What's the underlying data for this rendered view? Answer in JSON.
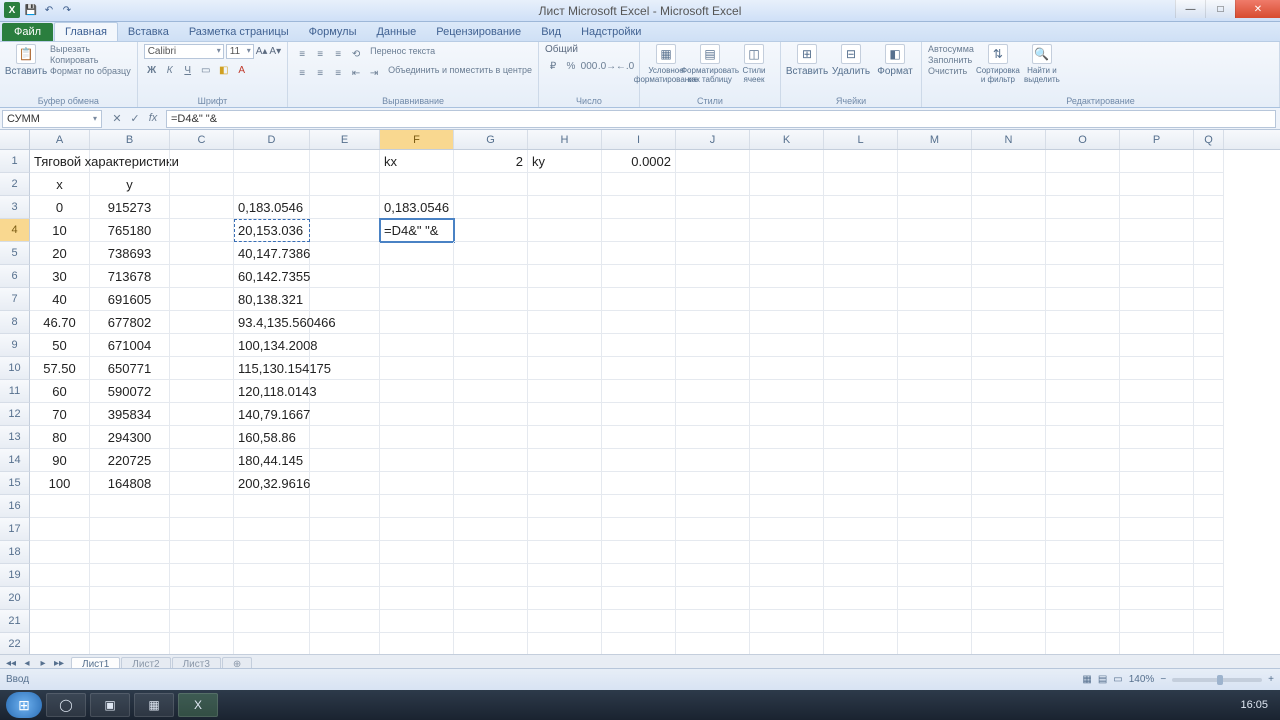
{
  "app": {
    "title": "Лист Microsoft Excel - Microsoft Excel"
  },
  "tabs": {
    "file": "Файл",
    "items": [
      "Главная",
      "Вставка",
      "Разметка страницы",
      "Формулы",
      "Данные",
      "Рецензирование",
      "Вид",
      "Надстройки"
    ],
    "active": 0
  },
  "ribbon": {
    "clipboard": {
      "paste": "Вставить",
      "cut": "Вырезать",
      "copy": "Копировать",
      "format": "Формат по образцу",
      "label": "Буфер обмена"
    },
    "font": {
      "name": "Calibri",
      "size": "11",
      "label": "Шрифт"
    },
    "alignment": {
      "wrap": "Перенос текста",
      "merge": "Объединить и поместить в центре",
      "label": "Выравнивание"
    },
    "number": {
      "format": "Общий",
      "label": "Число"
    },
    "styles": {
      "cond": "Условное форматирование",
      "table": "Форматировать как таблицу",
      "cell": "Стили ячеек",
      "label": "Стили"
    },
    "cells": {
      "insert": "Вставить",
      "delete": "Удалить",
      "format": "Формат",
      "label": "Ячейки"
    },
    "editing": {
      "sum": "Автосумма",
      "fill": "Заполнить",
      "clear": "Очистить",
      "sort": "Сортировка и фильтр",
      "find": "Найти и выделить",
      "label": "Редактирование"
    }
  },
  "namebox": "СУММ",
  "formula": "=D4&\" \"&",
  "columns": [
    "A",
    "B",
    "C",
    "D",
    "E",
    "F",
    "G",
    "H",
    "I",
    "J",
    "K",
    "L",
    "M",
    "N",
    "O",
    "P",
    "Q"
  ],
  "active_col": "F",
  "active_row": 4,
  "cells": {
    "r1": {
      "A": "Тяговой характеристики",
      "F": "kx",
      "G": "2",
      "H": "ky",
      "I": "0.0002"
    },
    "r2": {
      "A": "x",
      "B": "y"
    },
    "r3": {
      "A": "0",
      "B": "915273",
      "D": "0,183.0546",
      "F": "0,183.0546"
    },
    "r4": {
      "A": "10",
      "B": "765180",
      "D": "20,153.036",
      "F": "=D4&\" \"&"
    },
    "r5": {
      "A": "20",
      "B": "738693",
      "D": "40,147.7386"
    },
    "r6": {
      "A": "30",
      "B": "713678",
      "D": "60,142.7355"
    },
    "r7": {
      "A": "40",
      "B": "691605",
      "D": "80,138.321"
    },
    "r8": {
      "A": "46.70",
      "B": "677802",
      "D": "93.4,135.560466"
    },
    "r9": {
      "A": "50",
      "B": "671004",
      "D": "100,134.2008"
    },
    "r10": {
      "A": "57.50",
      "B": "650771",
      "D": "115,130.154175"
    },
    "r11": {
      "A": "60",
      "B": "590072",
      "D": "120,118.0143"
    },
    "r12": {
      "A": "70",
      "B": "395834",
      "D": "140,79.1667"
    },
    "r13": {
      "A": "80",
      "B": "294300",
      "D": "160,58.86"
    },
    "r14": {
      "A": "90",
      "B": "220725",
      "D": "180,44.145"
    },
    "r15": {
      "A": "100",
      "B": "164808",
      "D": "200,32.9616"
    }
  },
  "sheets": {
    "nav": [
      "◂◂",
      "◂",
      "▸",
      "▸▸"
    ],
    "tabs": [
      "Лист1",
      "Лист2",
      "Лист3"
    ],
    "active": 0,
    "new": "⊕"
  },
  "status": {
    "mode": "Ввод",
    "zoom": "140%"
  },
  "taskbar": {
    "clock": "16:05"
  }
}
